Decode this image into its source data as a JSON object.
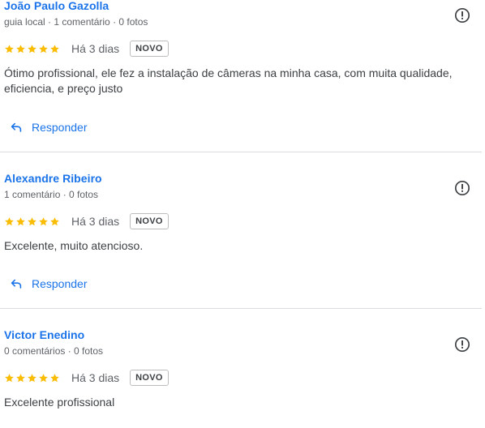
{
  "reviews": [
    {
      "name": "João Paulo Gazolla",
      "meta": "guia local · 1 comentário · 0 fotos",
      "rating": 5,
      "date": "Há 3 dias",
      "badge": "NOVO",
      "text": "Ótimo profissional, ele fez a instalação de câmeras na minha casa, com muita qualidade, eficiencia, e preço justo",
      "reply_label": "Responder"
    },
    {
      "name": "Alexandre Ribeiro",
      "meta": "1 comentário · 0 fotos",
      "rating": 5,
      "date": "Há 3 dias",
      "badge": "NOVO",
      "text": "Excelente, muito atencioso.",
      "reply_label": "Responder"
    },
    {
      "name": "Victor Enedino",
      "meta": "0 comentários · 0 fotos",
      "rating": 5,
      "date": "Há 3 dias",
      "badge": "NOVO",
      "text": "Excelente profissional"
    }
  ],
  "colors": {
    "star": "#fbbc04",
    "link": "#1a73e8",
    "divider": "#dadce0"
  },
  "icons": {
    "star": "star-icon",
    "report": "report-flag-icon",
    "reply": "reply-arrow-icon"
  }
}
